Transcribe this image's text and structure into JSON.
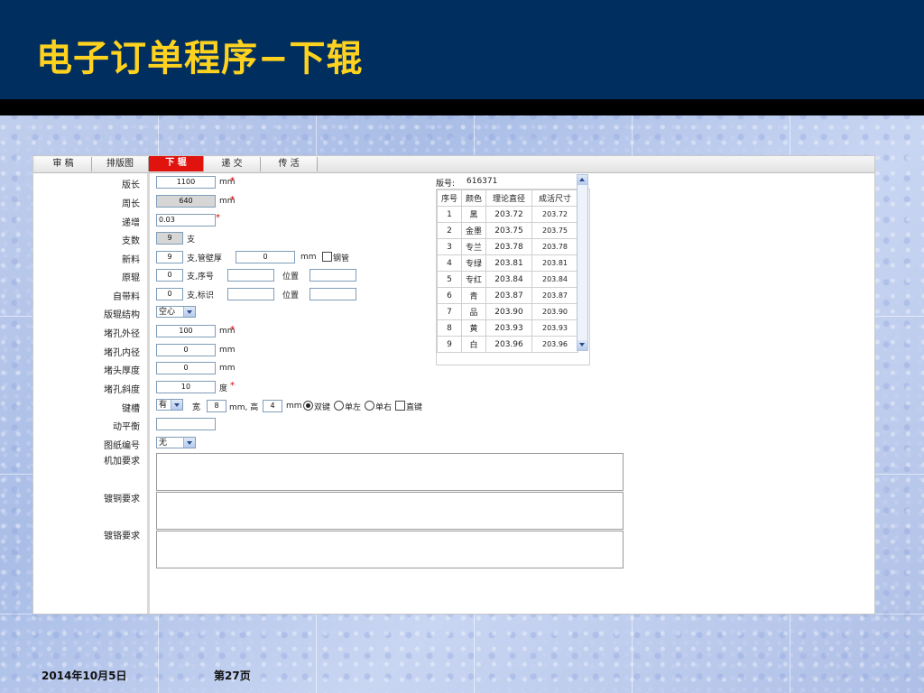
{
  "slide": {
    "title": "电子订单程序−下辊",
    "footer_date": "2014年10月5日",
    "footer_page": "第27页"
  },
  "tabs": [
    {
      "label": "审 稿",
      "active": false
    },
    {
      "label": "排版图",
      "active": false
    },
    {
      "label": "下 辊",
      "active": true
    },
    {
      "label": "递 交",
      "active": false
    },
    {
      "label": "传 活",
      "active": false
    }
  ],
  "form": {
    "label_length": "版长",
    "length_value": "1100",
    "label_circumference": "周长",
    "circumference_value": "640",
    "label_increment": "递增",
    "increment_value": "0.03",
    "label_count": "支数",
    "count_value": "9",
    "count_unit": "支",
    "label_new_material": "新料",
    "new_material_value": "9",
    "new_material_suffix": "支,管壁厚",
    "wall_thickness_value": "0",
    "steel_pipe_label": "钢管",
    "label_original_roller": "原辊",
    "original_roller_value": "0",
    "original_roller_suffix": "支,序号",
    "original_roller_position_label": "位置",
    "label_self_material": "自带料",
    "self_material_value": "0",
    "self_material_suffix": "支,标识",
    "self_material_position_label": "位置",
    "label_roller_structure": "版辊结构",
    "roller_structure_value": "空心",
    "label_plug_outer": "堵孔外径",
    "plug_outer_value": "100",
    "label_plug_inner": "堵孔内径",
    "plug_inner_value": "0",
    "label_plug_thickness": "堵头厚度",
    "plug_thickness_value": "0",
    "label_plug_slope": "堵孔斜度",
    "plug_slope_value": "10",
    "plug_slope_unit": "度",
    "label_keyway": "键槽",
    "keyway_value": "有",
    "keyway_width_label": "宽",
    "keyway_width_value": "8",
    "keyway_height_label": "mm, 高",
    "keyway_height_value": "4",
    "keyway_options": [
      "双键",
      "单左",
      "单右",
      "直键"
    ],
    "label_balance": "动平衡",
    "balance_value": "",
    "label_drawing_no": "图纸编号",
    "drawing_no_value": "无",
    "label_machining": "机加要求",
    "label_copper": "镀铜要求",
    "label_chrome": "镀铬要求",
    "unit_mm": "mm",
    "required_mark": "*"
  },
  "table": {
    "version_label": "版号:",
    "version_value": "616371",
    "headers": [
      "序号",
      "颜色",
      "理论直径",
      "成活尺寸"
    ],
    "rows": [
      [
        "1",
        "黑",
        "203.72",
        "203.72"
      ],
      [
        "2",
        "金墨",
        "203.75",
        "203.75"
      ],
      [
        "3",
        "专兰",
        "203.78",
        "203.78"
      ],
      [
        "4",
        "专绿",
        "203.81",
        "203.81"
      ],
      [
        "5",
        "专红",
        "203.84",
        "203.84"
      ],
      [
        "6",
        "青",
        "203.87",
        "203.87"
      ],
      [
        "7",
        "品",
        "203.90",
        "203.90"
      ],
      [
        "8",
        "黄",
        "203.93",
        "203.93"
      ],
      [
        "9",
        "白",
        "203.96",
        "203.96"
      ]
    ]
  },
  "colors": {
    "title_bar": "#002f5f",
    "title_text": "#ffd21f",
    "active_tab": "#e0130f",
    "required": "#e00000"
  }
}
